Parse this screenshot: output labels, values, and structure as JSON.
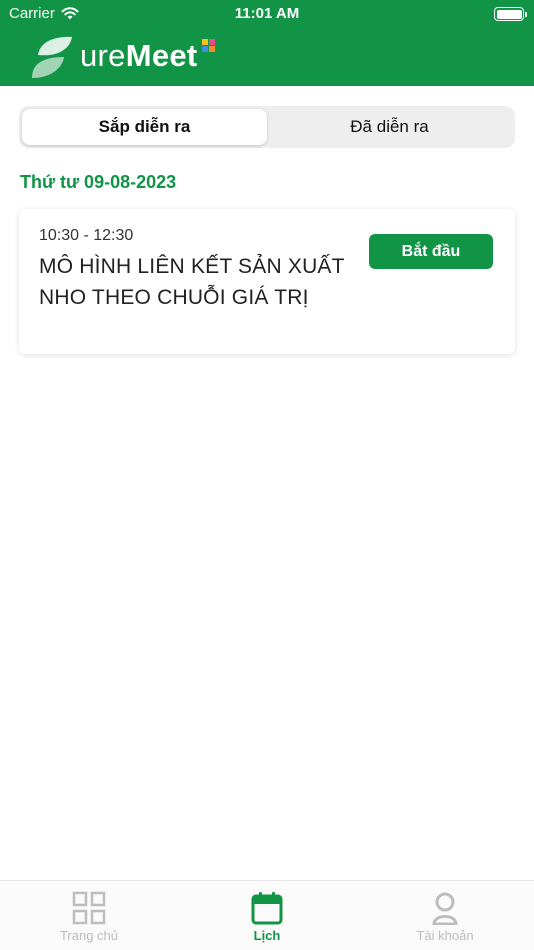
{
  "status_bar": {
    "carrier": "Carrier",
    "time": "11:01 AM",
    "icons": [
      "wifi-icon",
      "battery-icon"
    ]
  },
  "header": {
    "logo_text_thin": "ure",
    "logo_text_bold": "Meet",
    "background": "#129447"
  },
  "segment": {
    "tabs": [
      {
        "label": "Sắp diễn ra",
        "active": true
      },
      {
        "label": "Đã diễn ra",
        "active": false
      }
    ]
  },
  "date_heading": "Thứ tư 09-08-2023",
  "meetings": [
    {
      "time": "10:30 - 12:30",
      "title": "MÔ HÌNH LIÊN KẾT SẢN XUẤT NHO THEO CHUỖI GIÁ TRỊ",
      "button": "Bắt đầu"
    }
  ],
  "tabbar": {
    "items": [
      {
        "label": "Trang chủ",
        "icon": "grid-icon",
        "active": false
      },
      {
        "label": "Lịch",
        "icon": "calendar-icon",
        "active": true
      },
      {
        "label": "Tài khoản",
        "icon": "user-icon",
        "active": false
      }
    ]
  },
  "colors": {
    "primary": "#129447",
    "inactive": "#bdbdbd"
  }
}
